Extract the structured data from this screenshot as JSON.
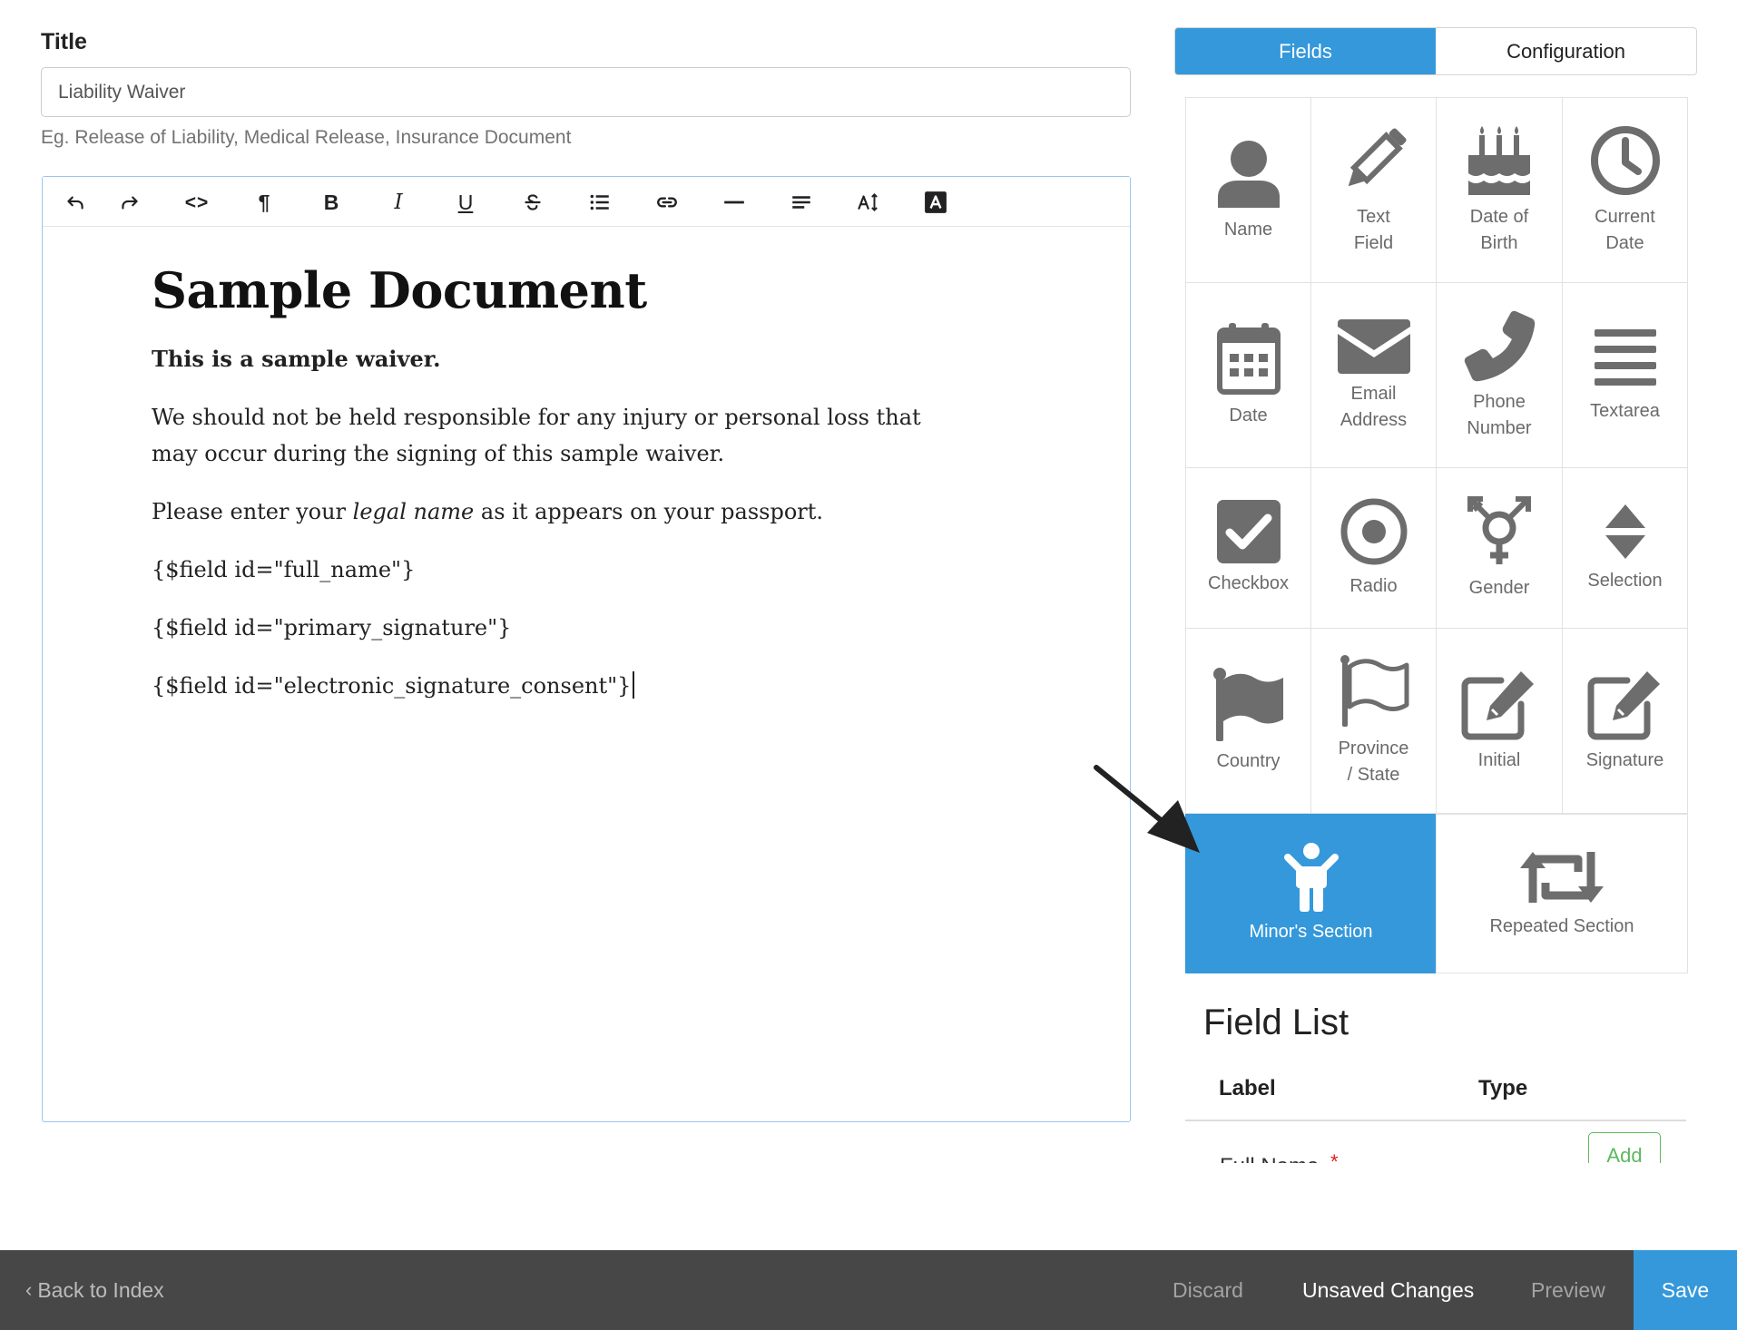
{
  "form": {
    "title_label": "Title",
    "title_value": "Liability Waiver",
    "title_hint": "Eg. Release of Liability, Medical Release, Insurance Document"
  },
  "toolbar": {
    "bold": "B",
    "italic": "I",
    "underline": "U",
    "paragraph": "¶",
    "code": "<>"
  },
  "document": {
    "heading": "Sample Document",
    "lead": "This is a sample waiver.",
    "paragraph1": "We should not be held responsible for any injury or personal loss that may occur during the signing of this sample waiver.",
    "paragraph2_before": "Please enter your ",
    "paragraph2_em": "legal name",
    "paragraph2_after": " as it appears on your passport.",
    "field1": "{$field id=\"full_name\"}",
    "field2": "{$field id=\"primary_signature\"}",
    "field3": "{$field id=\"electronic_signature_consent\"}"
  },
  "tabs": {
    "fields": "Fields",
    "configuration": "Configuration"
  },
  "fields": {
    "name": "Name",
    "text_field": [
      "Text",
      "Field"
    ],
    "date_of_birth": [
      "Date of",
      "Birth"
    ],
    "current_date": [
      "Current",
      "Date"
    ],
    "date": "Date",
    "email_address": [
      "Email",
      "Address"
    ],
    "phone_number": [
      "Phone",
      "Number"
    ],
    "textarea": "Textarea",
    "checkbox": "Checkbox",
    "radio": "Radio",
    "gender": "Gender",
    "selection": "Selection",
    "country": "Country",
    "province_state": [
      "Province",
      "/ State"
    ],
    "initial": "Initial",
    "signature": "Signature",
    "minors_section": "Minor's Section",
    "repeated_section": "Repeated Section"
  },
  "field_list": {
    "title": "Field List",
    "col_label": "Label",
    "col_type": "Type",
    "row1_label": "Full Name",
    "row1_required": "*",
    "add": "Add"
  },
  "bottom_bar": {
    "back": "Back to Index",
    "discard": "Discard",
    "unsaved": "Unsaved Changes",
    "preview": "Preview",
    "save": "Save"
  },
  "colors": {
    "accent": "#3498db",
    "icon_gray": "#6d6d6d",
    "bottom_bar": "#474747",
    "add_green": "#5cb85c"
  },
  "icons": {
    "undo": "undo-icon",
    "redo": "redo-icon",
    "code": "code-icon",
    "paragraph": "pilcrow-icon",
    "bold": "bold-icon",
    "italic": "italic-icon",
    "underline": "underline-icon",
    "strike": "strikethrough-icon",
    "list": "list-icon",
    "link": "link-icon",
    "hr": "horizontal-rule-icon",
    "align": "align-icon",
    "font_size": "font-size-icon",
    "text_color": "text-color-icon"
  }
}
